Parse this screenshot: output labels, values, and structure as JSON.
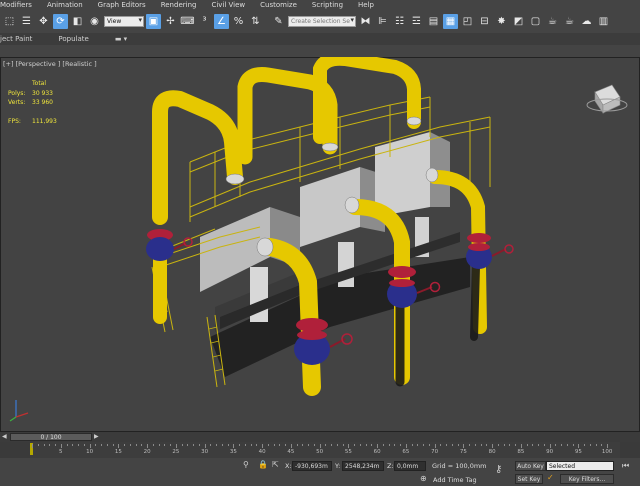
{
  "menu": [
    "Modifiers",
    "Animation",
    "Graph Editors",
    "Rendering",
    "Civil View",
    "Customize",
    "Scripting",
    "Help"
  ],
  "toolbar": {
    "reference_coord": "View",
    "selection_set_placeholder": "Create Selection Se"
  },
  "ribbon": {
    "items": [
      "ject Paint",
      "Populate"
    ]
  },
  "viewport": {
    "label": "[+] [Perspective ] [Realistic ]",
    "stats": {
      "total_label": "Total",
      "polys_label": "Polys:",
      "polys_value": "30 933",
      "verts_label": "Verts:",
      "verts_value": "33 960",
      "fps_label": "FPS:",
      "fps_value": "111,993"
    }
  },
  "timeline": {
    "frame_display": "0 / 100",
    "ticks": [
      "5",
      "10",
      "15",
      "20",
      "25",
      "30",
      "35",
      "40",
      "45",
      "50",
      "55",
      "60",
      "65",
      "70",
      "75",
      "80",
      "85",
      "90",
      "95",
      "100"
    ]
  },
  "status": {
    "x_label": "X:",
    "x_value": "-930,693m",
    "y_label": "Y:",
    "y_value": "2548,234m",
    "z_label": "Z:",
    "z_value": "0,0mm",
    "grid": "Grid = 100,0mm",
    "auto_key": "Auto Key",
    "selected": "Selected",
    "set_key": "Set Key",
    "key_filters": "Key Filters...",
    "add_time_tag": "Add Time Tag"
  },
  "colors": {
    "pipe_yellow": "#e6c800",
    "valve_blue": "#2a2f8c",
    "flange_red": "#b0203a",
    "railing_yellow": "#c9b410",
    "stats_yellow": "#f0e63c",
    "accent_blue": "#5aa0e6"
  }
}
